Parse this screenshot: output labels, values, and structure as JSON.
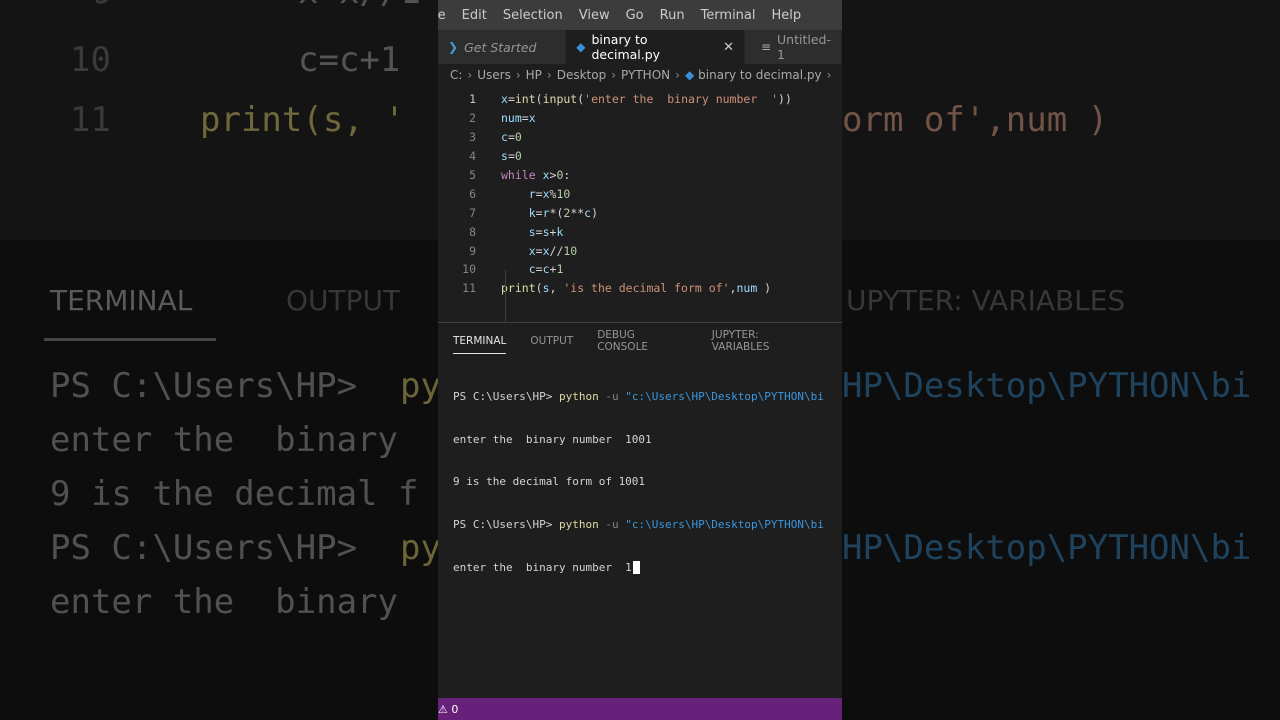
{
  "background": {
    "code_lines": [
      {
        "num": "9",
        "text": "x=x//1"
      },
      {
        "num": "10",
        "text": "c=c+1"
      },
      {
        "num": "11",
        "text": "print(s, '",
        "tail": "orm of',num )"
      }
    ],
    "panel_tabs": [
      "TERMINAL",
      "OUTPUT",
      "UPYTER: VARIABLES"
    ],
    "term_lines": [
      "PS C:\\Users\\HP> ",
      "enter the  binary ",
      "9 is the decimal f",
      "PS C:\\Users\\HP> ",
      "enter the  binary "
    ],
    "term_fragments": {
      "py": "py",
      "path_right": "HP\\Desktop\\PYTHON\\bi"
    }
  },
  "menubar": {
    "items": [
      "le",
      "Edit",
      "Selection",
      "View",
      "Go",
      "Run",
      "Terminal",
      "Help"
    ]
  },
  "tabs": [
    {
      "label": "Get Started",
      "icon": "vscode-icon",
      "active": false
    },
    {
      "label": "binary to decimal.py",
      "icon": "python-icon",
      "active": true,
      "close": "✕"
    },
    {
      "label": "Untitled-1",
      "icon": "text-file-icon",
      "active": false
    }
  ],
  "breadcrumb": [
    "C:",
    "Users",
    "HP",
    "Desktop",
    "PYTHON",
    "binary to decimal.py"
  ],
  "editor": {
    "lines": [
      {
        "n": "1",
        "code": "x=int(input('enter the  binary number  '))"
      },
      {
        "n": "2",
        "code": "num=x"
      },
      {
        "n": "3",
        "code": "c=0"
      },
      {
        "n": "4",
        "code": "s=0"
      },
      {
        "n": "5",
        "code": "while x>0:"
      },
      {
        "n": "6",
        "code": "    r=x%10"
      },
      {
        "n": "7",
        "code": "    k=r*(2**c)"
      },
      {
        "n": "8",
        "code": "    s=s+k"
      },
      {
        "n": "9",
        "code": "    x=x//10"
      },
      {
        "n": "10",
        "code": "    c=c+1"
      },
      {
        "n": "11",
        "code": "print(s, 'is the decimal form of',num )"
      }
    ]
  },
  "panel": {
    "tabs": [
      "TERMINAL",
      "OUTPUT",
      "DEBUG CONSOLE",
      "JUPYTER: VARIABLES"
    ],
    "terminal": {
      "prompt": "PS C:\\Users\\HP> ",
      "cmd": "python",
      "flag": " -u ",
      "path": "\"c:\\Users\\HP\\Desktop\\PYTHON\\bi",
      "line2": "enter the  binary number  1001",
      "line3": "9 is the decimal form of 1001",
      "line5": "enter the  binary number  1"
    }
  },
  "status": {
    "text": "⚠ 0"
  },
  "colors": {
    "status_bar": "#68217a",
    "editor_bg": "#1e1e1e",
    "menubar": "#3c3c3c"
  }
}
